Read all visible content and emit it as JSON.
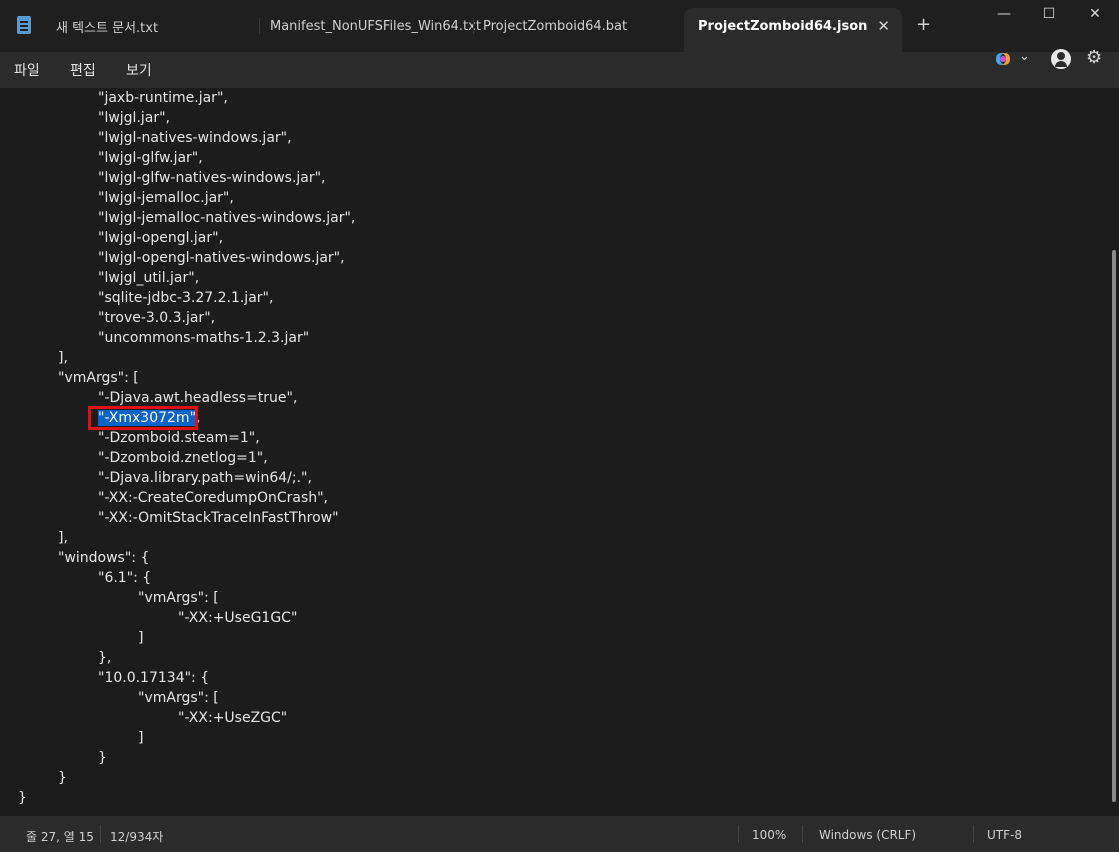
{
  "tabs": [
    {
      "label": "새 텍스트 문서.txt"
    },
    {
      "label": "Manifest_NonUFSFiles_Win64.txt"
    },
    {
      "label": "ProjectZomboid64.bat"
    },
    {
      "label": "ProjectZomboid64.json"
    }
  ],
  "new_tab_glyph": "+",
  "close_glyph": "✕",
  "window": {
    "minimize": "—",
    "maximize": "☐",
    "close": "✕"
  },
  "menu": {
    "file": "파일",
    "edit": "편집",
    "view": "보기"
  },
  "toolbar": {
    "settings_glyph": "⚙",
    "chevron_glyph": "⌄"
  },
  "editor": {
    "lines": [
      {
        "indent": 2,
        "text": "\"jaxb-runtime.jar\","
      },
      {
        "indent": 2,
        "text": "\"lwjgl.jar\","
      },
      {
        "indent": 2,
        "text": "\"lwjgl-natives-windows.jar\","
      },
      {
        "indent": 2,
        "text": "\"lwjgl-glfw.jar\","
      },
      {
        "indent": 2,
        "text": "\"lwjgl-glfw-natives-windows.jar\","
      },
      {
        "indent": 2,
        "text": "\"lwjgl-jemalloc.jar\","
      },
      {
        "indent": 2,
        "text": "\"lwjgl-jemalloc-natives-windows.jar\","
      },
      {
        "indent": 2,
        "text": "\"lwjgl-opengl.jar\","
      },
      {
        "indent": 2,
        "text": "\"lwjgl-opengl-natives-windows.jar\","
      },
      {
        "indent": 2,
        "text": "\"lwjgl_util.jar\","
      },
      {
        "indent": 2,
        "text": "\"sqlite-jdbc-3.27.2.1.jar\","
      },
      {
        "indent": 2,
        "text": "\"trove-3.0.3.jar\","
      },
      {
        "indent": 2,
        "text": "\"uncommons-maths-1.2.3.jar\""
      },
      {
        "indent": 1,
        "text": "],"
      },
      {
        "indent": 1,
        "text": "\"vmArgs\": ["
      },
      {
        "indent": 2,
        "text": "\"-Djava.awt.headless=true\","
      },
      {
        "indent": 2,
        "text": "\"-Xmx3072m\",",
        "selected": "\"-Xmx3072m\""
      },
      {
        "indent": 2,
        "text": "\"-Dzomboid.steam=1\","
      },
      {
        "indent": 2,
        "text": "\"-Dzomboid.znetlog=1\","
      },
      {
        "indent": 2,
        "text": "\"-Djava.library.path=win64/;.\","
      },
      {
        "indent": 2,
        "text": "\"-XX:-CreateCoredumpOnCrash\","
      },
      {
        "indent": 2,
        "text": "\"-XX:-OmitStackTraceInFastThrow\""
      },
      {
        "indent": 1,
        "text": "],"
      },
      {
        "indent": 1,
        "text": "\"windows\": {"
      },
      {
        "indent": 2,
        "text": "\"6.1\": {"
      },
      {
        "indent": 3,
        "text": "\"vmArgs\": ["
      },
      {
        "indent": 4,
        "text": "\"-XX:+UseG1GC\""
      },
      {
        "indent": 3,
        "text": "]"
      },
      {
        "indent": 2,
        "text": "},"
      },
      {
        "indent": 2,
        "text": "\"10.0.17134\": {"
      },
      {
        "indent": 3,
        "text": "\"vmArgs\": ["
      },
      {
        "indent": 4,
        "text": "\"-XX:+UseZGC\""
      },
      {
        "indent": 3,
        "text": "]"
      },
      {
        "indent": 2,
        "text": "}"
      },
      {
        "indent": 1,
        "text": "}"
      },
      {
        "indent": 0,
        "text": "}"
      }
    ]
  },
  "status": {
    "position": "줄 27, 열 15",
    "chars": "12/934자",
    "zoom": "100%",
    "line_ending": "Windows (CRLF)",
    "encoding": "UTF-8"
  }
}
